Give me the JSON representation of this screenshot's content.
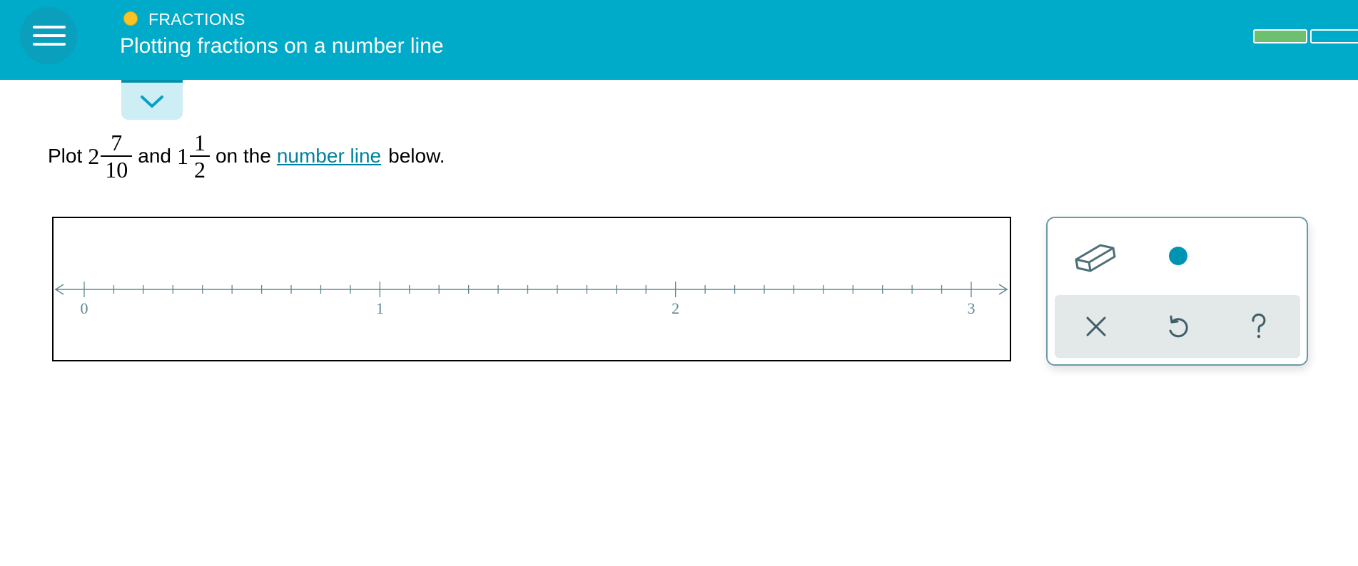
{
  "header": {
    "topic": "FRACTIONS",
    "title": "Plotting fractions on a number line",
    "progress_segments": [
      {
        "state": "complete",
        "color": "#6cc06f"
      },
      {
        "state": "empty",
        "color": "#ffffff"
      }
    ],
    "accent": "#00aac9",
    "topic_dot_color": "#f7c325"
  },
  "icons": {
    "menu": "hamburger-icon",
    "collapse": "chevron-down-icon",
    "eraser": "eraser-icon",
    "point": "point-icon",
    "clear": "close-icon",
    "undo": "undo-icon",
    "help": "help-icon"
  },
  "question": {
    "prefix": "Plot",
    "n1": {
      "whole": "2",
      "num": "7",
      "den": "10"
    },
    "conj": "and",
    "n2": {
      "whole": "1",
      "num": "1",
      "den": "2"
    },
    "mid": "on the",
    "link": "number line",
    "suffix": "below."
  },
  "number_line": {
    "min": 0,
    "max": 3,
    "minor_step": 0.1,
    "labels": [
      "0",
      "1",
      "2",
      "3"
    ],
    "color": "#5f8791"
  },
  "tools": {
    "point_color": "#0094b3"
  }
}
